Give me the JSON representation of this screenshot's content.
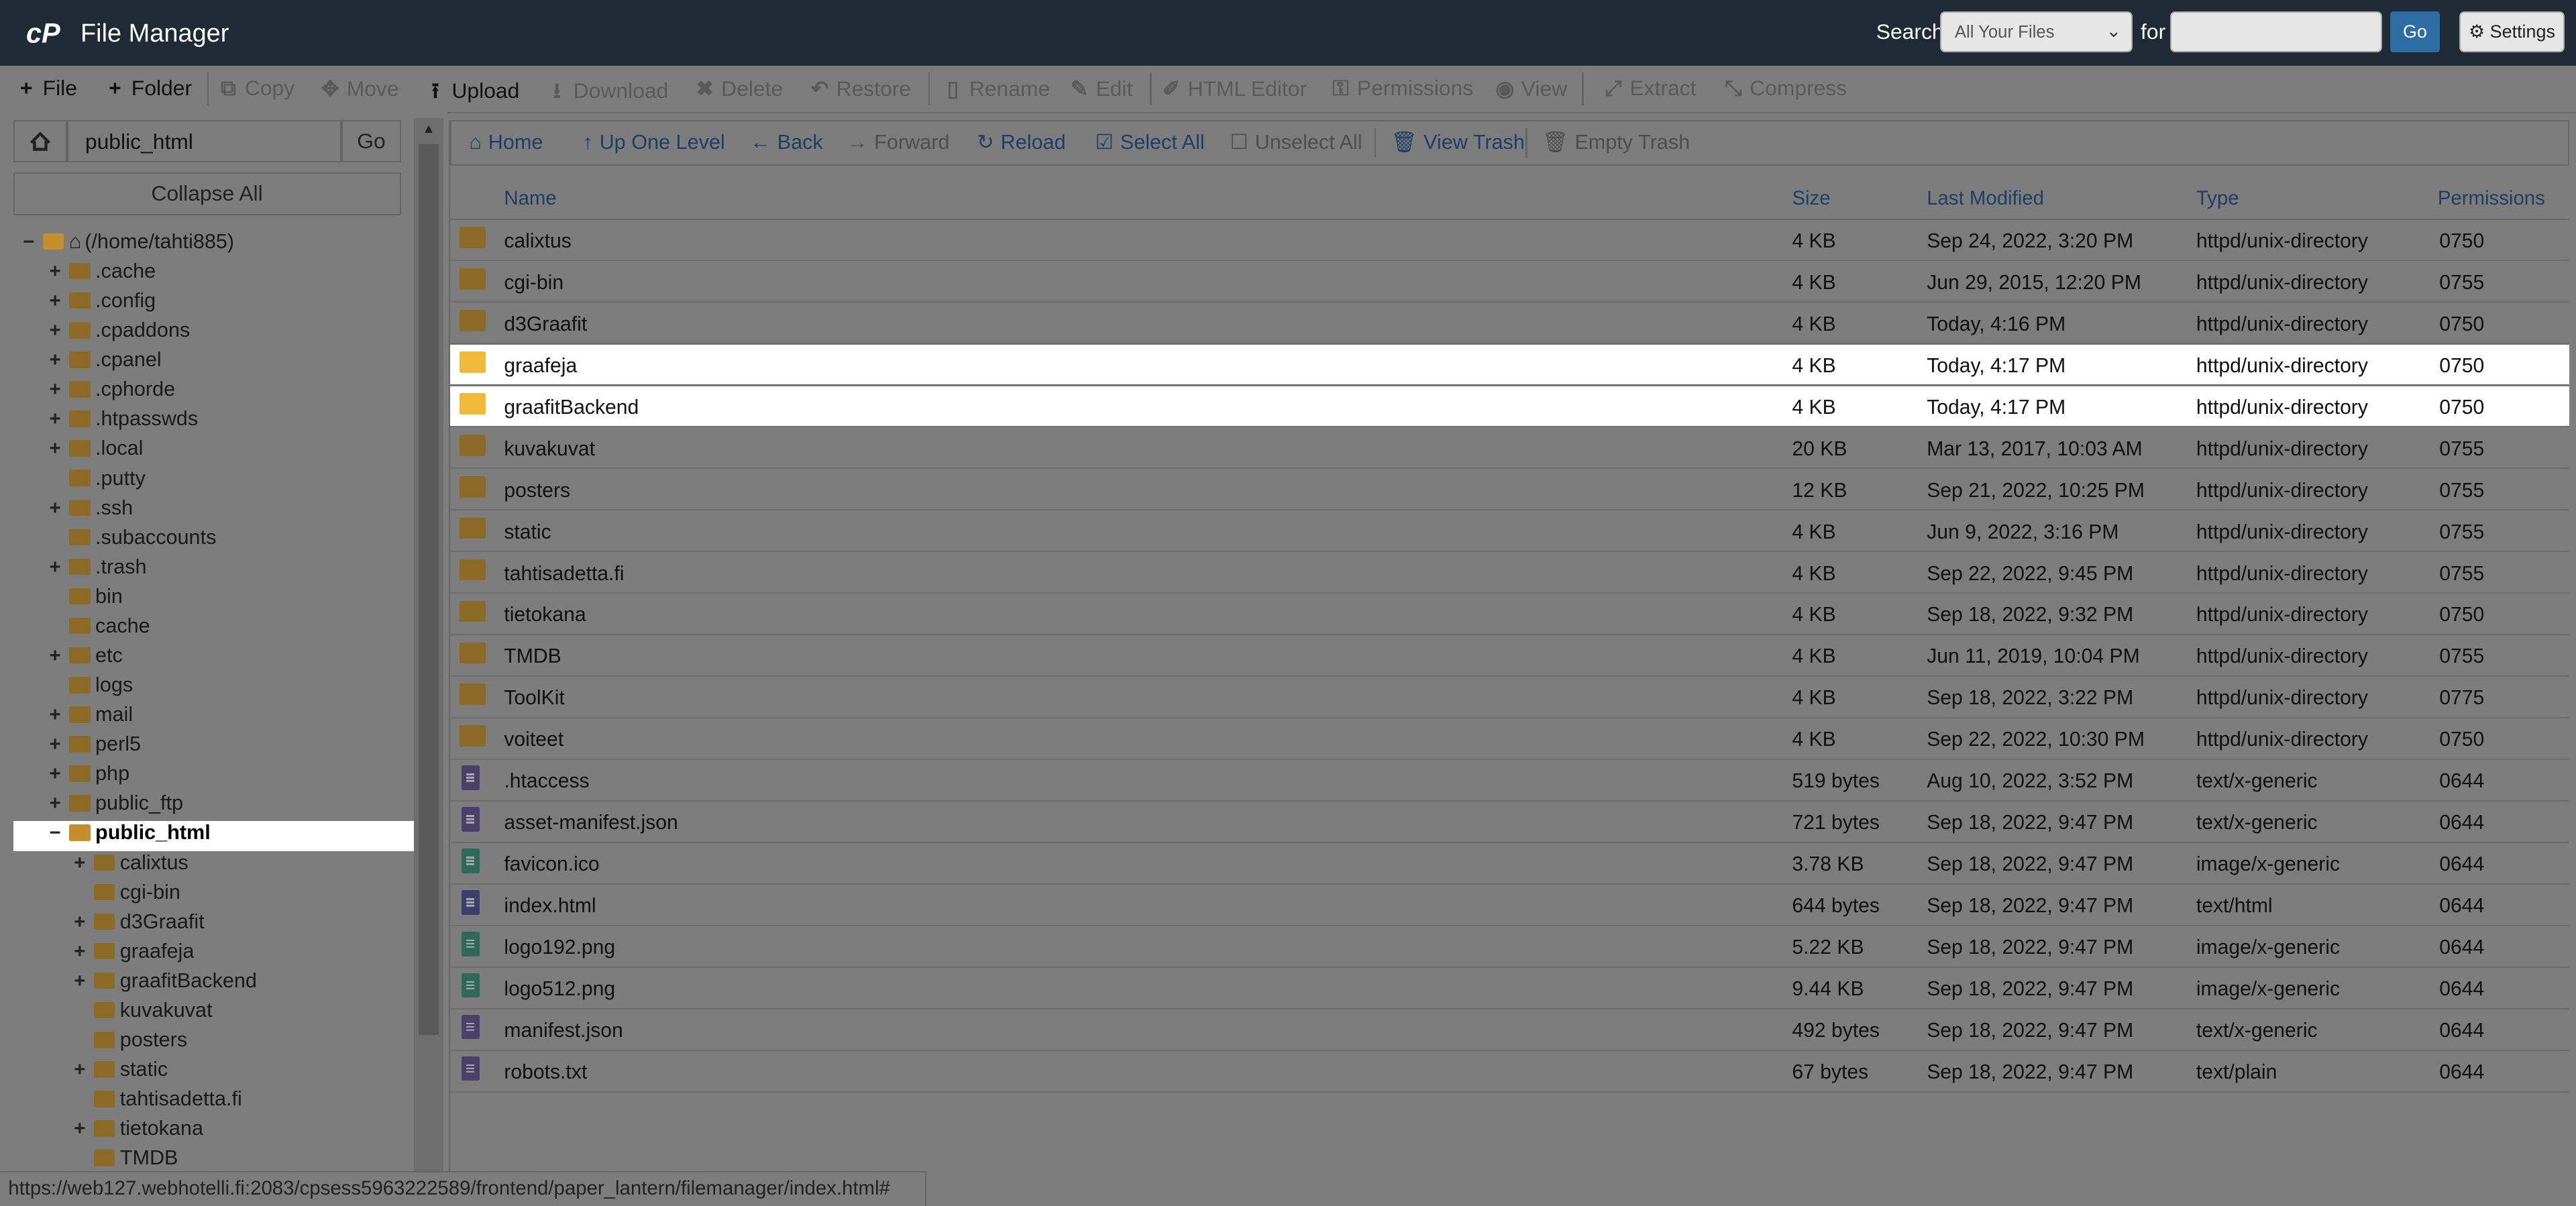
{
  "header": {
    "app_title": "File Manager",
    "search_label": "Search",
    "search_scope": "All Your Files",
    "for_label": "for",
    "search_value": "",
    "go_label": "Go",
    "settings_label": "Settings",
    "logo_icon": "cpanel-logo-icon"
  },
  "toolbar": [
    {
      "label": "File",
      "icon": "plus-icon",
      "glyph": "+",
      "active": true
    },
    {
      "label": "Folder",
      "icon": "plus-icon",
      "glyph": "+",
      "active": true
    },
    {
      "label": "Copy",
      "icon": "copy-icon",
      "glyph": "⧉",
      "active": false
    },
    {
      "label": "Move",
      "icon": "move-icon",
      "glyph": "✥",
      "active": false
    },
    {
      "label": "Upload",
      "icon": "upload-icon",
      "glyph": "⭱",
      "active": true
    },
    {
      "label": "Download",
      "icon": "download-icon",
      "glyph": "⭳",
      "active": false
    },
    {
      "label": "Delete",
      "icon": "close-icon",
      "glyph": "✖",
      "active": false
    },
    {
      "label": "Restore",
      "icon": "undo-icon",
      "glyph": "↶",
      "active": false
    },
    {
      "label": "Rename",
      "icon": "file-icon",
      "glyph": "▯",
      "active": false
    },
    {
      "label": "Edit",
      "icon": "pencil-icon",
      "glyph": "✎",
      "active": false
    },
    {
      "label": "HTML Editor",
      "icon": "edit-box-icon",
      "glyph": "✐",
      "active": false
    },
    {
      "label": "Permissions",
      "icon": "key-icon",
      "glyph": "⚿",
      "active": false
    },
    {
      "label": "View",
      "icon": "eye-icon",
      "glyph": "◉",
      "active": false
    },
    {
      "label": "Extract",
      "icon": "expand-icon",
      "glyph": "⤢",
      "active": false
    },
    {
      "label": "Compress",
      "icon": "compress-icon",
      "glyph": "⤡",
      "active": false
    }
  ],
  "left": {
    "path_value": "public_html",
    "go_label": "Go",
    "collapse_label": "Collapse All",
    "tree": [
      {
        "label": "(/home/tahti885)",
        "level": 0,
        "toggle": "−",
        "open": true,
        "home": true
      },
      {
        "label": ".cache",
        "level": 1,
        "toggle": "+"
      },
      {
        "label": ".config",
        "level": 1,
        "toggle": "+"
      },
      {
        "label": ".cpaddons",
        "level": 1,
        "toggle": "+"
      },
      {
        "label": ".cpanel",
        "level": 1,
        "toggle": "+"
      },
      {
        "label": ".cphorde",
        "level": 1,
        "toggle": "+"
      },
      {
        "label": ".htpasswds",
        "level": 1,
        "toggle": "+"
      },
      {
        "label": ".local",
        "level": 1,
        "toggle": "+"
      },
      {
        "label": ".putty",
        "level": 1,
        "toggle": ""
      },
      {
        "label": ".ssh",
        "level": 1,
        "toggle": "+"
      },
      {
        "label": ".subaccounts",
        "level": 1,
        "toggle": ""
      },
      {
        "label": ".trash",
        "level": 1,
        "toggle": "+"
      },
      {
        "label": "bin",
        "level": 1,
        "toggle": ""
      },
      {
        "label": "cache",
        "level": 1,
        "toggle": ""
      },
      {
        "label": "etc",
        "level": 1,
        "toggle": "+"
      },
      {
        "label": "logs",
        "level": 1,
        "toggle": ""
      },
      {
        "label": "mail",
        "level": 1,
        "toggle": "+"
      },
      {
        "label": "perl5",
        "level": 1,
        "toggle": "+"
      },
      {
        "label": "php",
        "level": 1,
        "toggle": "+"
      },
      {
        "label": "public_ftp",
        "level": 1,
        "toggle": "+"
      },
      {
        "label": "public_html",
        "level": 1,
        "toggle": "−",
        "open": true,
        "selected": true
      },
      {
        "label": "calixtus",
        "level": 2,
        "toggle": "+"
      },
      {
        "label": "cgi-bin",
        "level": 2,
        "toggle": ""
      },
      {
        "label": "d3Graafit",
        "level": 2,
        "toggle": "+"
      },
      {
        "label": "graafeja",
        "level": 2,
        "toggle": "+"
      },
      {
        "label": "graafitBackend",
        "level": 2,
        "toggle": "+"
      },
      {
        "label": "kuvakuvat",
        "level": 2,
        "toggle": ""
      },
      {
        "label": "posters",
        "level": 2,
        "toggle": ""
      },
      {
        "label": "static",
        "level": 2,
        "toggle": "+"
      },
      {
        "label": "tahtisadetta.fi",
        "level": 2,
        "toggle": ""
      },
      {
        "label": "tietokana",
        "level": 2,
        "toggle": "+"
      },
      {
        "label": "TMDB",
        "level": 2,
        "toggle": ""
      }
    ]
  },
  "actions": [
    {
      "label": "Home",
      "icon": "home-icon",
      "glyph": "⌂",
      "dim": false
    },
    {
      "label": "Up One Level",
      "icon": "arrow-up-icon",
      "glyph": "↑",
      "dim": false
    },
    {
      "label": "Back",
      "icon": "arrow-left-icon",
      "glyph": "←",
      "dim": false
    },
    {
      "label": "Forward",
      "icon": "arrow-right-icon",
      "glyph": "→",
      "dim": true
    },
    {
      "label": "Reload",
      "icon": "reload-icon",
      "glyph": "↻",
      "dim": false
    },
    {
      "label": "Select All",
      "icon": "checkbox-checked-icon",
      "glyph": "☑",
      "dim": false
    },
    {
      "label": "Unselect All",
      "icon": "checkbox-empty-icon",
      "glyph": "☐",
      "dim": true
    },
    {
      "label": "View Trash",
      "icon": "trash-icon",
      "glyph": "🗑",
      "dim": false
    },
    {
      "label": "Empty Trash",
      "icon": "trash-icon",
      "glyph": "🗑",
      "dim": true
    }
  ],
  "table": {
    "columns": [
      "Name",
      "Size",
      "Last Modified",
      "Type",
      "Permissions"
    ],
    "rows": [
      {
        "name": "calixtus",
        "size": "4 KB",
        "modified": "Sep 24, 2022, 3:20 PM",
        "type": "httpd/unix-directory",
        "perms": "0750",
        "kind": "dir"
      },
      {
        "name": "cgi-bin",
        "size": "4 KB",
        "modified": "Jun 29, 2015, 12:20 PM",
        "type": "httpd/unix-directory",
        "perms": "0755",
        "kind": "dir"
      },
      {
        "name": "d3Graafit",
        "size": "4 KB",
        "modified": "Today, 4:16 PM",
        "type": "httpd/unix-directory",
        "perms": "0750",
        "kind": "dir"
      },
      {
        "name": "graafeja",
        "size": "4 KB",
        "modified": "Today, 4:17 PM",
        "type": "httpd/unix-directory",
        "perms": "0750",
        "kind": "dir",
        "highlight": true
      },
      {
        "name": "graafitBackend",
        "size": "4 KB",
        "modified": "Today, 4:17 PM",
        "type": "httpd/unix-directory",
        "perms": "0750",
        "kind": "dir",
        "highlight": true
      },
      {
        "name": "kuvakuvat",
        "size": "20 KB",
        "modified": "Mar 13, 2017, 10:03 AM",
        "type": "httpd/unix-directory",
        "perms": "0755",
        "kind": "dir"
      },
      {
        "name": "posters",
        "size": "12 KB",
        "modified": "Sep 21, 2022, 10:25 PM",
        "type": "httpd/unix-directory",
        "perms": "0755",
        "kind": "dir"
      },
      {
        "name": "static",
        "size": "4 KB",
        "modified": "Jun 9, 2022, 3:16 PM",
        "type": "httpd/unix-directory",
        "perms": "0755",
        "kind": "dir"
      },
      {
        "name": "tahtisadetta.fi",
        "size": "4 KB",
        "modified": "Sep 22, 2022, 9:45 PM",
        "type": "httpd/unix-directory",
        "perms": "0755",
        "kind": "dir"
      },
      {
        "name": "tietokana",
        "size": "4 KB",
        "modified": "Sep 18, 2022, 9:32 PM",
        "type": "httpd/unix-directory",
        "perms": "0750",
        "kind": "dir"
      },
      {
        "name": "TMDB",
        "size": "4 KB",
        "modified": "Jun 11, 2019, 10:04 PM",
        "type": "httpd/unix-directory",
        "perms": "0755",
        "kind": "dir"
      },
      {
        "name": "ToolKit",
        "size": "4 KB",
        "modified": "Sep 18, 2022, 3:22 PM",
        "type": "httpd/unix-directory",
        "perms": "0775",
        "kind": "dir"
      },
      {
        "name": "voiteet",
        "size": "4 KB",
        "modified": "Sep 22, 2022, 10:30 PM",
        "type": "httpd/unix-directory",
        "perms": "0750",
        "kind": "dir"
      },
      {
        "name": ".htaccess",
        "size": "519 bytes",
        "modified": "Aug 10, 2022, 3:52 PM",
        "type": "text/x-generic",
        "perms": "0644",
        "kind": "file"
      },
      {
        "name": "asset-manifest.json",
        "size": "721 bytes",
        "modified": "Sep 18, 2022, 9:47 PM",
        "type": "text/x-generic",
        "perms": "0644",
        "kind": "file"
      },
      {
        "name": "favicon.ico",
        "size": "3.78 KB",
        "modified": "Sep 18, 2022, 9:47 PM",
        "type": "image/x-generic",
        "perms": "0644",
        "kind": "img"
      },
      {
        "name": "index.html",
        "size": "644 bytes",
        "modified": "Sep 18, 2022, 9:47 PM",
        "type": "text/html",
        "perms": "0644",
        "kind": "html"
      },
      {
        "name": "logo192.png",
        "size": "5.22 KB",
        "modified": "Sep 18, 2022, 9:47 PM",
        "type": "image/x-generic",
        "perms": "0644",
        "kind": "img"
      },
      {
        "name": "logo512.png",
        "size": "9.44 KB",
        "modified": "Sep 18, 2022, 9:47 PM",
        "type": "image/x-generic",
        "perms": "0644",
        "kind": "img"
      },
      {
        "name": "manifest.json",
        "size": "492 bytes",
        "modified": "Sep 18, 2022, 9:47 PM",
        "type": "text/x-generic",
        "perms": "0644",
        "kind": "file"
      },
      {
        "name": "robots.txt",
        "size": "67 bytes",
        "modified": "Sep 18, 2022, 9:47 PM",
        "type": "text/plain",
        "perms": "0644",
        "kind": "file"
      }
    ]
  },
  "status_url": "https://web127.webhotelli.fi:2083/cpsess5963222589/frontend/paper_lantern/filemanager/index.html#"
}
